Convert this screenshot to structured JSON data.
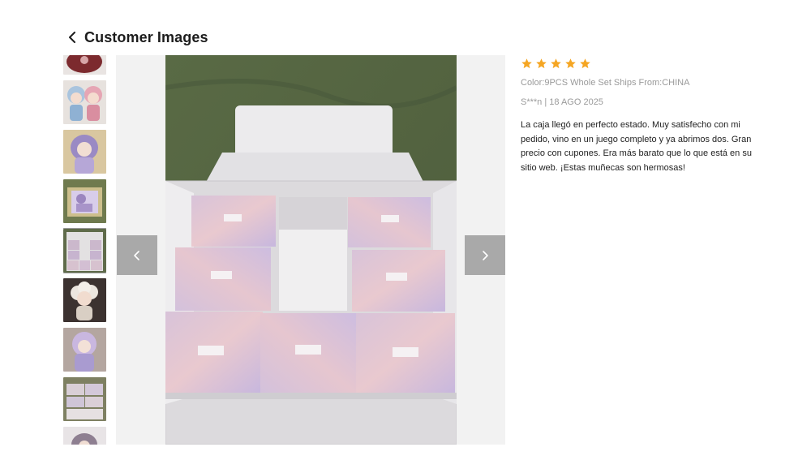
{
  "header": {
    "back_icon": "chevron-left-icon",
    "title": "Customer Images"
  },
  "thumbnails": {
    "count_visible": 9,
    "selected_index": 4,
    "items": [
      {
        "subject": "red figure top (partially cut)"
      },
      {
        "subject": "blue and pink dolls"
      },
      {
        "subject": "purple-haired doll"
      },
      {
        "subject": "doll in green box"
      },
      {
        "subject": "open shipping box with 9 pastel boxes"
      },
      {
        "subject": "white curly-haired doll"
      },
      {
        "subject": "lavender doll"
      },
      {
        "subject": "stacked boxes"
      },
      {
        "subject": "doll (partially cut)"
      }
    ]
  },
  "viewer": {
    "prev_icon": "chevron-left-icon",
    "next_icon": "chevron-right-icon"
  },
  "review": {
    "rating": 5,
    "max_rating": 5,
    "star_color": "#f5a623",
    "variant": "Color:9PCS Whole Set Ships From:CHINA",
    "author_date": "S***n | 18 AGO 2025",
    "text": "La caja llegó en perfecto estado. Muy satisfecho con mi pedido, vino en un juego completo y ya abrimos dos. Gran precio con cupones. Era más barato que lo que está en su sitio web. ¡Estas muñecas son hermosas!"
  }
}
